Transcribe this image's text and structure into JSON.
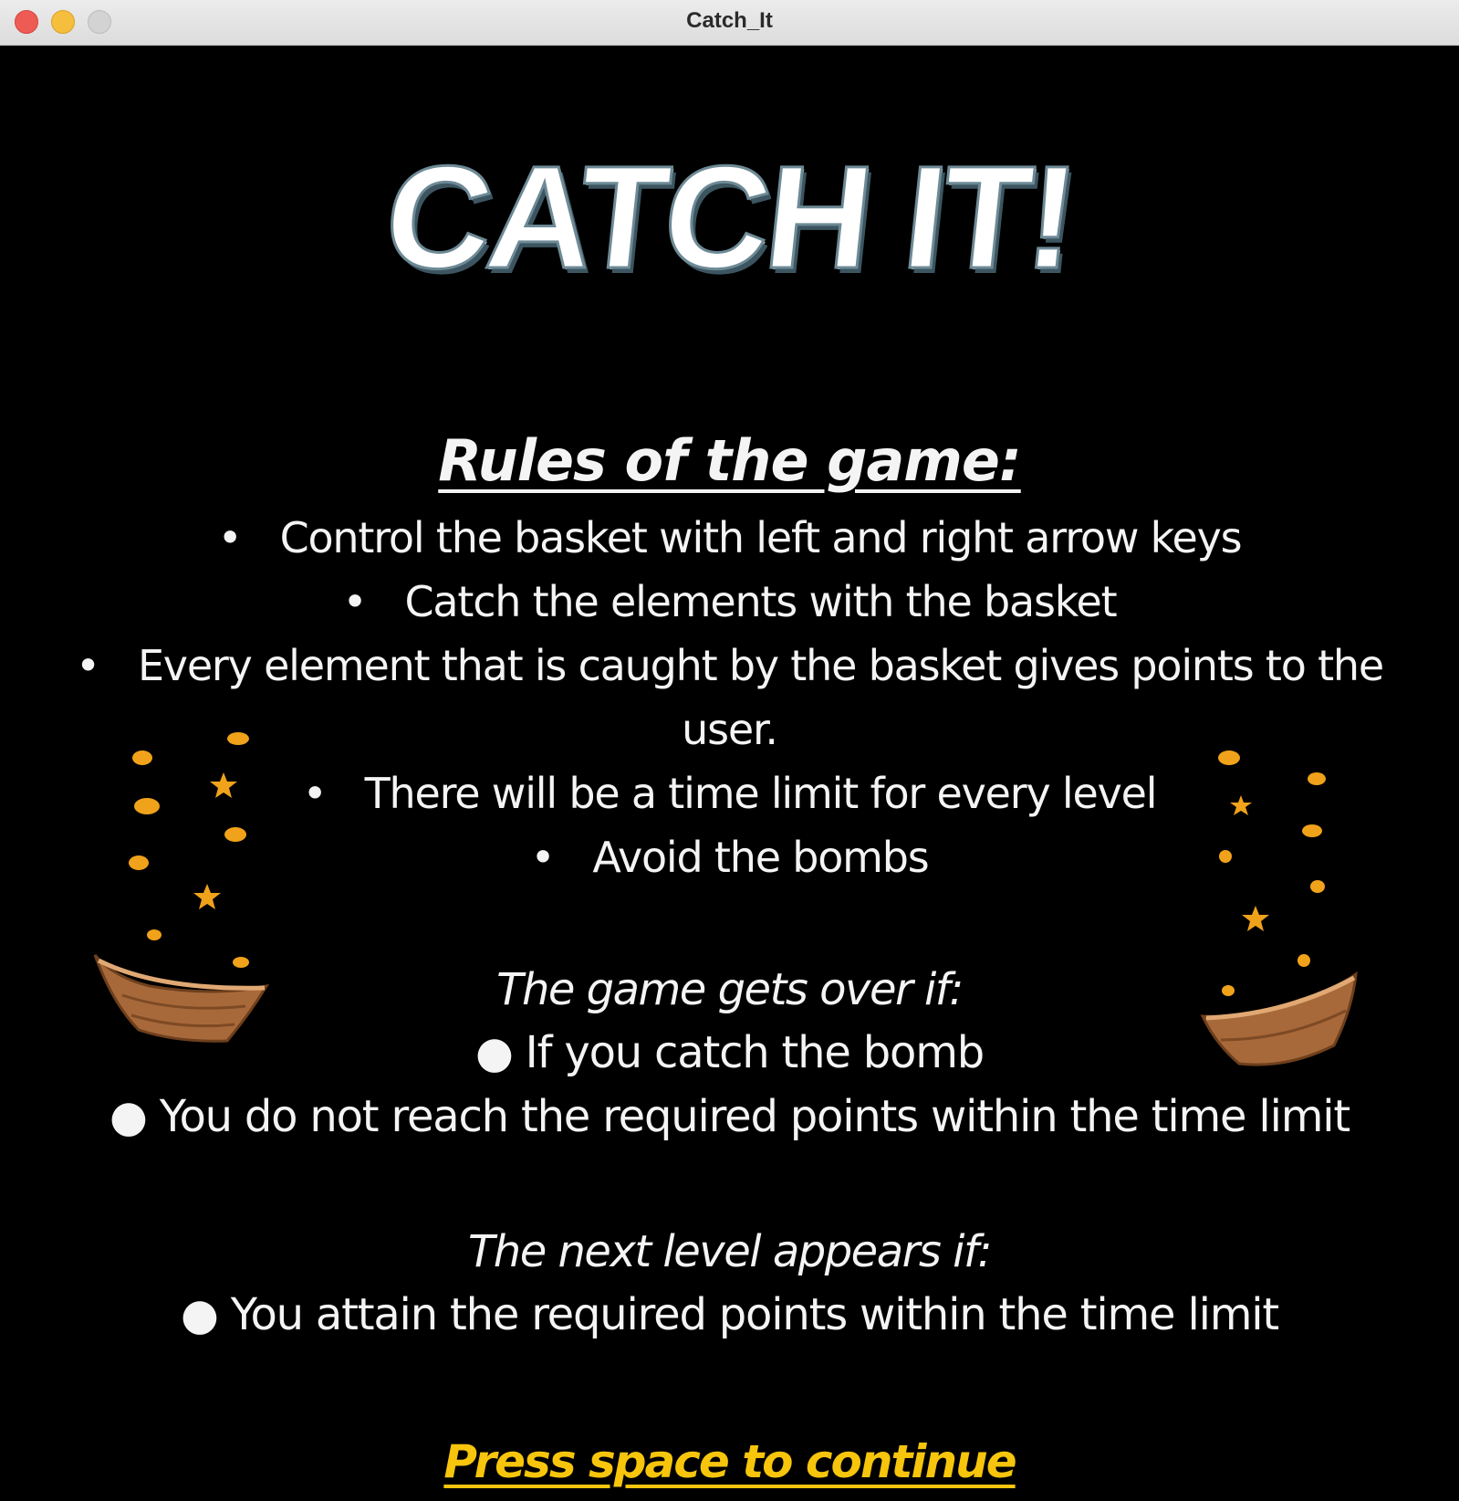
{
  "window": {
    "title": "Catch_It",
    "buttons": [
      "close",
      "minimize",
      "zoom"
    ]
  },
  "game": {
    "logo_text": "CATCH IT!",
    "rules_title": "Rules of the game:",
    "bullet_glyph": "•",
    "rules": [
      "Control the basket with left and right arrow keys",
      "Catch the elements with the basket",
      "Every element that is caught by the basket gives points to the",
      "user.",
      "There will be a time limit for every level",
      "Avoid the bombs"
    ],
    "game_over_heading": "The game gets over if:",
    "game_over_conditions": [
      "● If you catch the bomb",
      "● You do not reach the required points within the time limit"
    ],
    "next_level_heading": "The next level appears if:",
    "next_level_conditions": [
      "● You attain the required points within the time limit"
    ],
    "continue_prompt": "Press space to continue"
  },
  "colors": {
    "background": "#000000",
    "text": "#f4f4f4",
    "prompt": "#f6c50c",
    "falling_items": "#f0a21a",
    "basket": "#a8693a"
  },
  "decorations": {
    "left": "basket-with-falling-coins-and-stars",
    "right": "basket-with-falling-coins-and-stars"
  }
}
